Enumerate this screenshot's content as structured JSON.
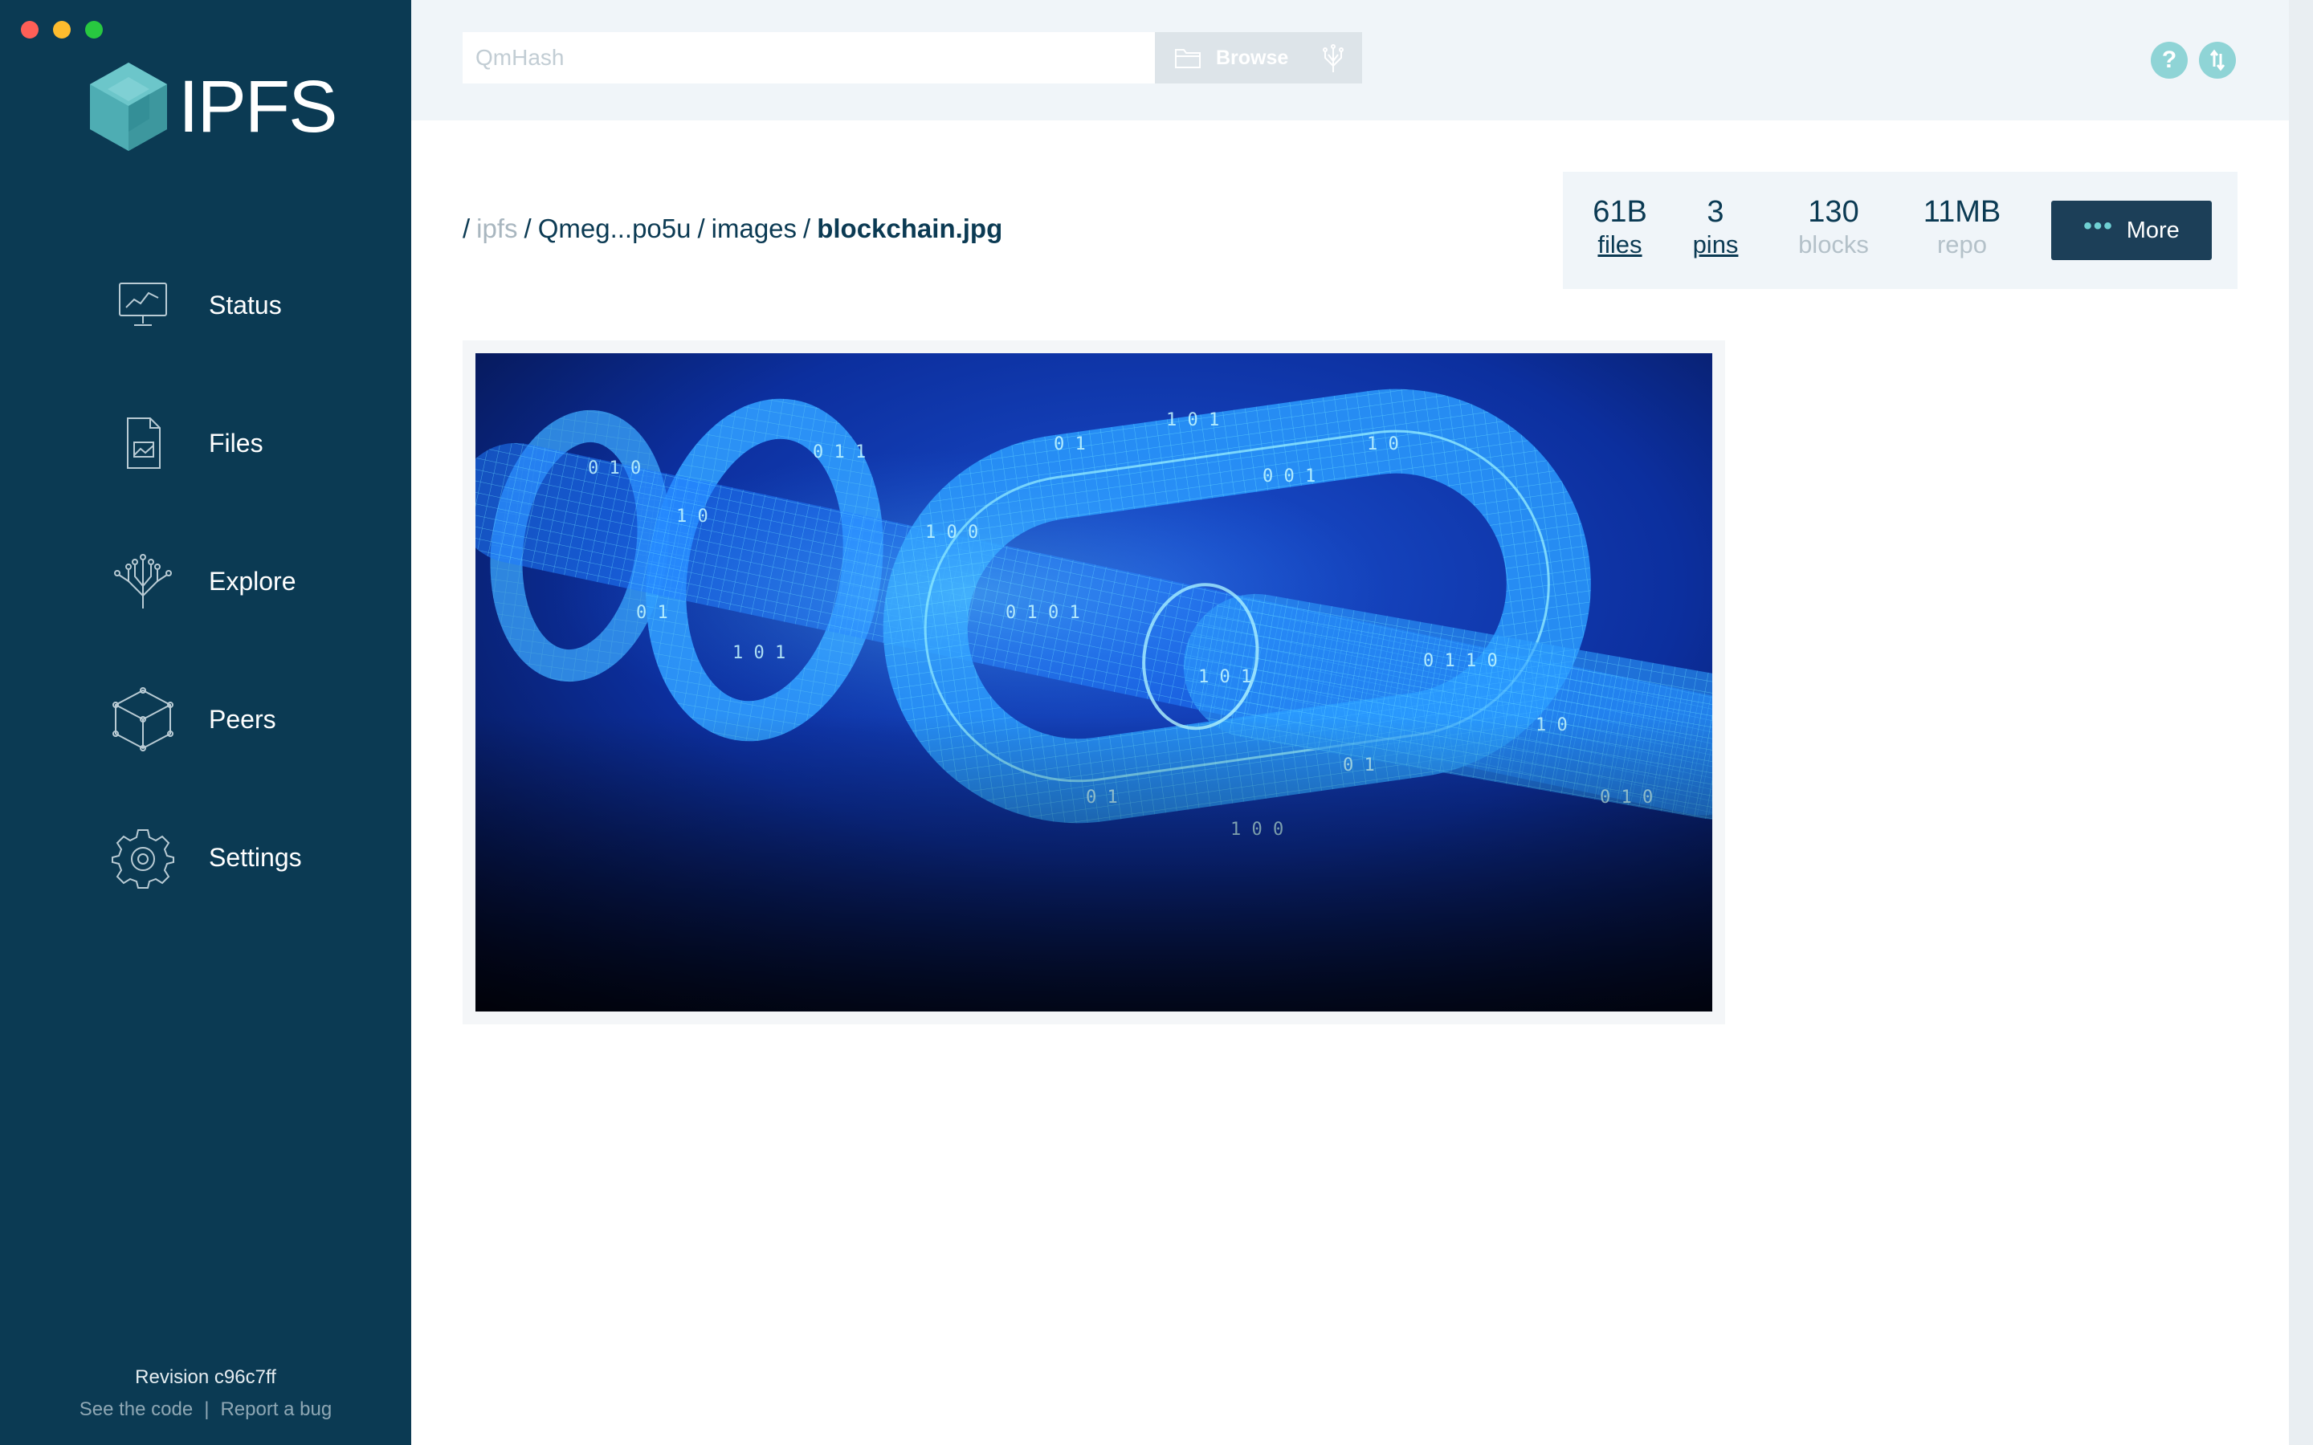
{
  "window": {
    "traffic_lights": {
      "close": "#fe5f57",
      "minimize": "#febc2e",
      "zoom": "#28c840"
    }
  },
  "sidebar": {
    "logo_text": "IPFS",
    "background": "#0b3a53",
    "items": [
      {
        "label": "Status",
        "icon": "monitor-chart-icon"
      },
      {
        "label": "Files",
        "icon": "document-icon"
      },
      {
        "label": "Explore",
        "icon": "tree-icon"
      },
      {
        "label": "Peers",
        "icon": "cube-icon"
      },
      {
        "label": "Settings",
        "icon": "gear-icon"
      }
    ],
    "revision": "Revision c96c7ff",
    "see_code": "See the code",
    "separator": "|",
    "report_bug": "Report a bug"
  },
  "topbar": {
    "search_placeholder": "QmHash",
    "browse_label": "Browse",
    "help_icon": "help-icon",
    "connection_icon": "updown-arrows-icon",
    "accent": "#8fd4d6"
  },
  "breadcrumb": {
    "root": "ipfs",
    "hash": "Qmeg...po5u",
    "folder": "images",
    "current": "blockchain.jpg",
    "separator": "/"
  },
  "stats": [
    {
      "value": "61B",
      "label": "files"
    },
    {
      "value": "3",
      "label": "pins"
    },
    {
      "value": "130",
      "label": "blocks"
    },
    {
      "value": "11MB",
      "label": "repo"
    }
  ],
  "more_button": {
    "label": "More",
    "dots": "•••"
  },
  "preview": {
    "alt": "blockchain.jpg"
  }
}
